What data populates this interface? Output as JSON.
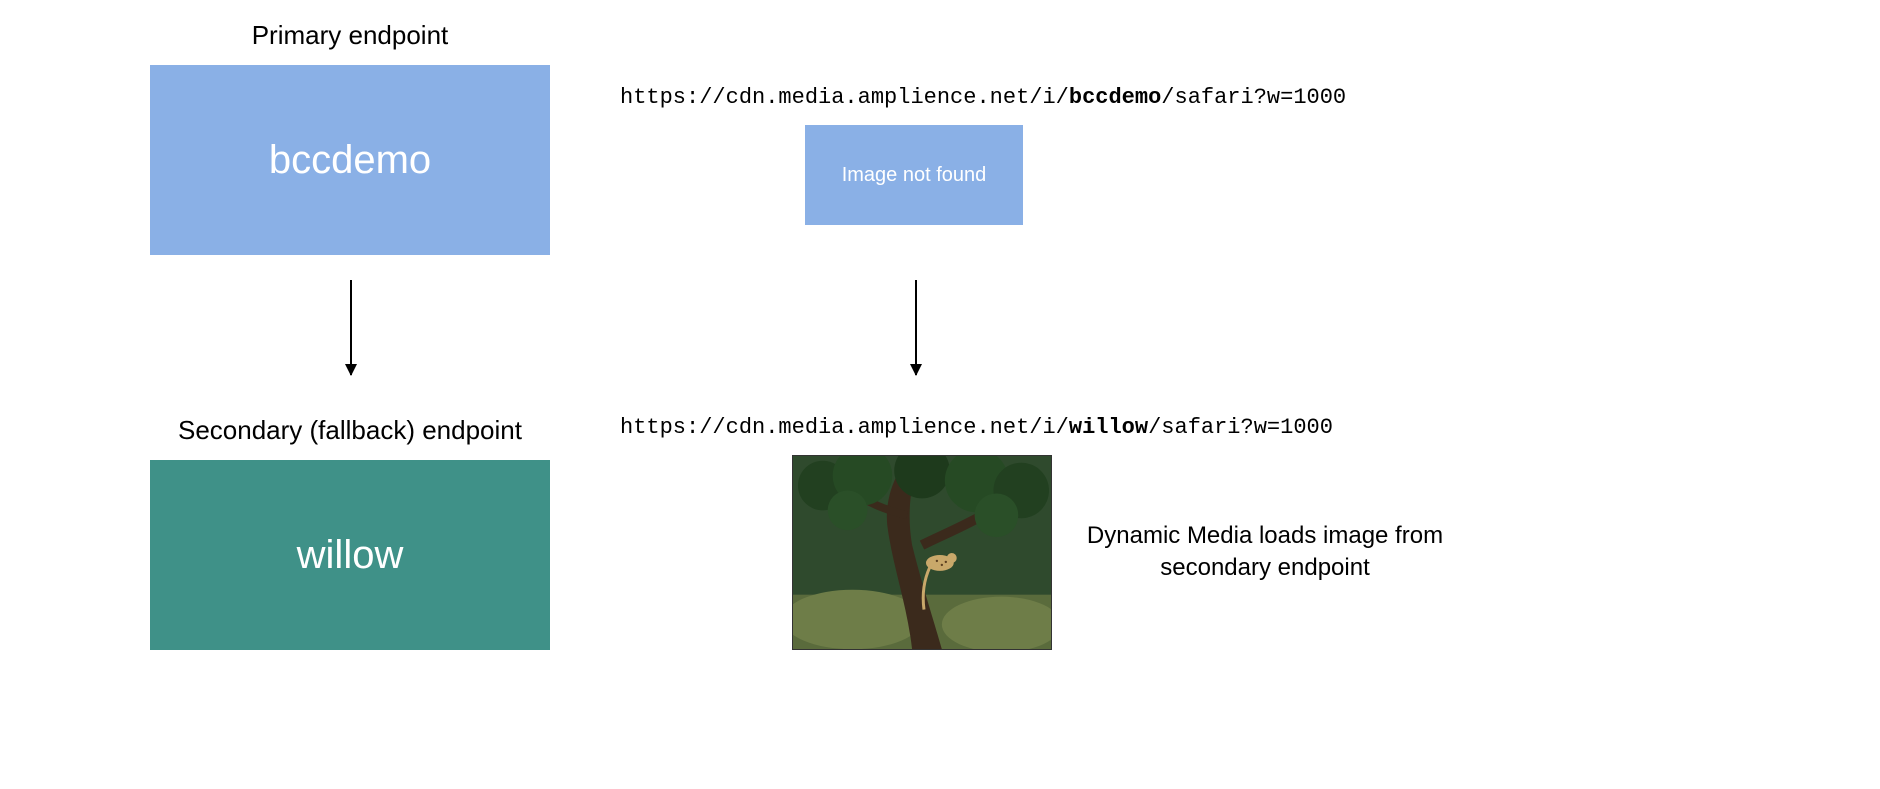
{
  "left": {
    "primary_label": "Primary endpoint",
    "primary_name": "bccdemo",
    "secondary_label": "Secondary (fallback) endpoint",
    "secondary_name": "willow"
  },
  "right": {
    "url_prefix": "https://cdn.media.amplience.net/i/",
    "url_primary_account": "bccdemo",
    "url_secondary_account": "willow",
    "url_suffix": "/safari?w=1000",
    "not_found_label": "Image not found",
    "caption_line1": "Dynamic Media loads image from",
    "caption_line2": "secondary endpoint"
  },
  "colors": {
    "primary_box": "#8ab0e6",
    "secondary_box": "#3f9188"
  }
}
